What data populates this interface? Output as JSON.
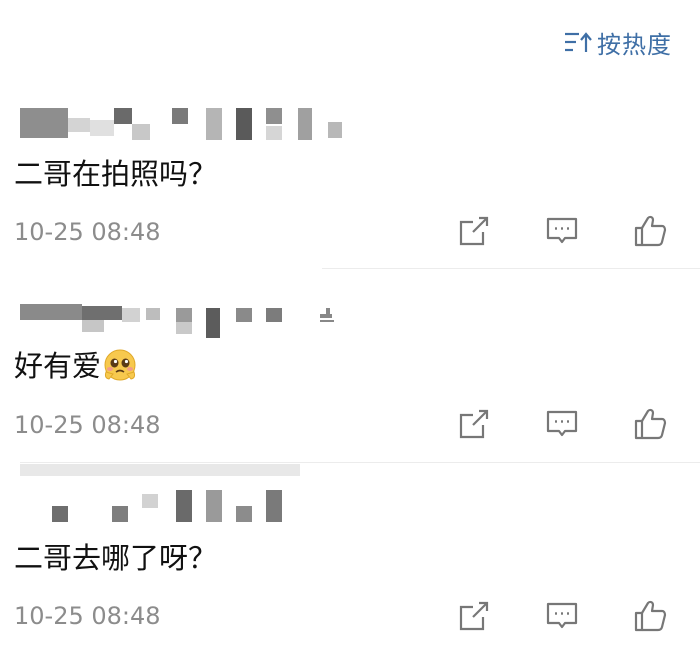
{
  "sort": {
    "label": "按热度",
    "icon": "sort-descending-icon",
    "color": "#3f6fa6"
  },
  "comments": [
    {
      "username": "",
      "text": "二哥在拍照吗？",
      "time": "10-25 08:48",
      "has_emoji": false
    },
    {
      "username": "",
      "text": "好有爱",
      "time": "10-25 08:48",
      "has_emoji": true,
      "emoji": "pleading-face-emoji"
    },
    {
      "username": "",
      "text": "二哥去哪了呀？",
      "time": "10-25 08:48",
      "has_emoji": false
    }
  ],
  "action_icons": [
    "share-icon",
    "reply-icon",
    "like-icon"
  ],
  "colors": {
    "text": "#111111",
    "timestamp": "#8c8c8c",
    "icon": "#777777",
    "divider": "#ececec"
  }
}
